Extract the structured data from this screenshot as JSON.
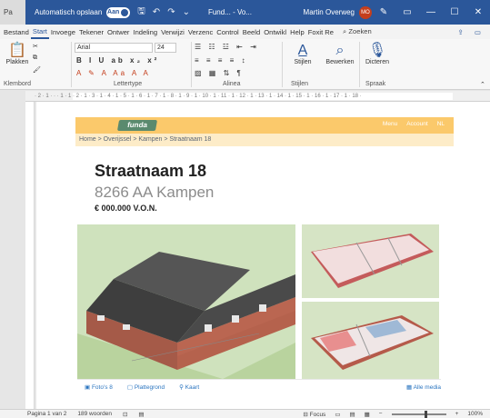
{
  "titlebar": {
    "stub": "Pa",
    "autosave_label": "Automatisch opslaan",
    "autosave_state": "Aan",
    "doc_title": "Fund... - Vo...",
    "user_name": "Martin Overweg",
    "user_initials": "MO",
    "min": "—",
    "max": "☐",
    "close": "✕"
  },
  "tabs": {
    "items": [
      "Bestand",
      "Start",
      "Invoege",
      "Tekener",
      "Ontwer",
      "Indeling",
      "Verwijzi",
      "Verzenc",
      "Control",
      "Beeld",
      "Ontwikl",
      "Help",
      "Foxit Re"
    ],
    "active": "Start",
    "search_label": "Zoeken"
  },
  "ribbon": {
    "paste_label": "Plakken",
    "clipboard_group": "Klembord",
    "font_name": "Arial",
    "font_size": "24",
    "font_group": "Lettertype",
    "paragraph_group": "Alinea",
    "styles_label": "Stijlen",
    "styles_group": "Stijlen",
    "edit_label": "Bewerken",
    "dictate_label": "Dicteren",
    "voice_group": "Spraak",
    "format_buttons": "B  I  U  ab  x₂  x²",
    "aa_buttons": "A  ✎  A  Aa  A  A"
  },
  "ruler": {
    "ticks": "· 2 · 1 · · · 1 · 1 · 2 · 1 · 3 · 1 · 4 · 1 · 5 · 1 · 6 · 1 · 7 · 1 · 8 · 1 · 9 · 1 · 10 · 1 · 11 · 1 · 12 · 1 · 13 · 1 · 14 · 1 · 15 · 1 · 16 · 1 · 17 · 1 · 18 ·"
  },
  "document": {
    "logo": "funda",
    "nav": [
      "Menu",
      "Account",
      "NL"
    ],
    "breadcrumb": "Home > Overijssel > Kampen > Straatnaam 18",
    "street": "Straatnaam 18",
    "postal": "8266 AA Kampen",
    "price": "€ 000.000 V.O.N.",
    "photo_links": [
      "Foto's 8",
      "Plattegrond",
      "Kaart"
    ],
    "all_media": "Alle media"
  },
  "statusbar": {
    "page": "Pagina 1 van 2",
    "words": "189 woorden",
    "focus": "Focus",
    "zoom": "100%"
  }
}
